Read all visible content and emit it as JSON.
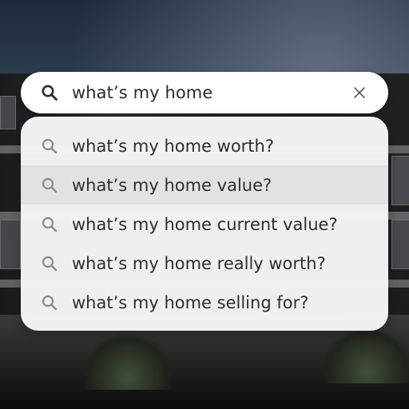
{
  "search": {
    "query": "what’s my home",
    "clear_icon": "close-icon",
    "search_icon": "search-icon"
  },
  "suggestions": {
    "items": [
      {
        "label": "what’s my home worth?",
        "highlighted": false
      },
      {
        "label": "what’s my home value?",
        "highlighted": true
      },
      {
        "label": "what’s my home current value?",
        "highlighted": false
      },
      {
        "label": "what’s my home really worth?",
        "highlighted": false
      },
      {
        "label": "what’s my home selling for?",
        "highlighted": false
      }
    ]
  },
  "colors": {
    "search_box": "#ffffff",
    "panel": "#f6f6f6",
    "highlight_row": "#e2e2e2",
    "text": "#2e2e2e",
    "icon_lead": "#2b2b2b",
    "icon_suggestion": "#8a8a8a"
  }
}
